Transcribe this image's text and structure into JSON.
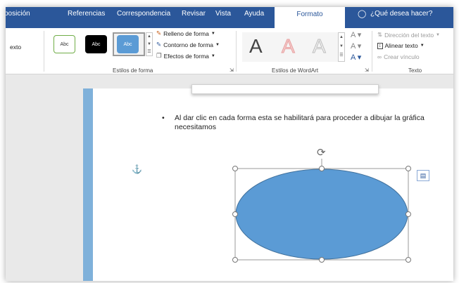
{
  "tabs": [
    "posición",
    "Referencias",
    "Correspondencia",
    "Revisar",
    "Vista",
    "Ayuda",
    "Formato"
  ],
  "search": {
    "label": "¿Qué desea hacer?"
  },
  "ribbon": {
    "left_cut_label": "exto",
    "shape_styles": {
      "thumbnails": [
        {
          "label": "Abc",
          "style": "outline-green"
        },
        {
          "label": "Abc",
          "style": "black"
        },
        {
          "label": "Abc",
          "style": "blue-selected"
        }
      ],
      "commands": [
        "Relleno de forma",
        "Contorno de forma",
        "Efectos de forma"
      ],
      "group_title": "Estilos de forma"
    },
    "wordart": {
      "letters": [
        "A",
        "A",
        "A"
      ],
      "group_title": "Estilos de WordArt"
    },
    "text": {
      "commands": [
        "Dirección del texto",
        "Alinear texto",
        "Crear vínculo"
      ],
      "group_title": "Texto"
    }
  },
  "document": {
    "bullet": "•",
    "bullet_line1": "Al dar clic en cada forma esta se habilitará para proceder a dibujar la gráfica",
    "bullet_line2": "necesitamos",
    "anchor_icon": "anchor-icon",
    "shape_fill": "#5b9bd5",
    "layout_options_icon": "layout-options-icon"
  },
  "colors": {
    "ribbon_tab_bg": "#2b579a",
    "shape_fill": "#5b9bd5",
    "shape_stroke": "#41719c"
  }
}
